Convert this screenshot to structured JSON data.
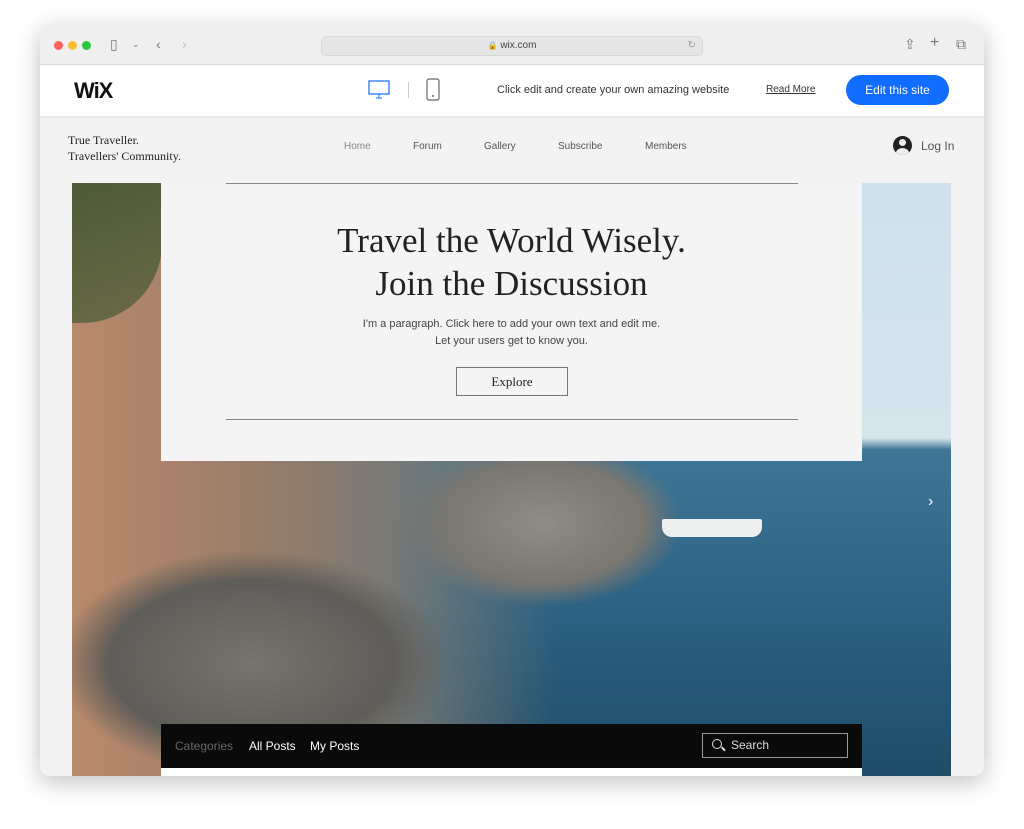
{
  "browser": {
    "url": "wix.com"
  },
  "wix_bar": {
    "logo": "WiX",
    "promo": "Click edit and create your own amazing website",
    "read_more": "Read More",
    "edit_button": "Edit this site",
    "accent": "#116dff"
  },
  "site": {
    "name_line1": "True Traveller.",
    "name_line2": "Travellers' Community.",
    "nav": [
      "Home",
      "Forum",
      "Gallery",
      "Subscribe",
      "Members"
    ],
    "login": "Log In"
  },
  "hero": {
    "title_line1": "Travel the World Wisely.",
    "title_line2": "Join the Discussion",
    "para_line1": "I'm a paragraph. Click here to add your own text and edit me.",
    "para_line2": "Let your users get to know you.",
    "button": "Explore"
  },
  "blog_bar": {
    "categories": "Categories",
    "all_posts": "All Posts",
    "my_posts": "My Posts",
    "search_placeholder": "Search"
  }
}
